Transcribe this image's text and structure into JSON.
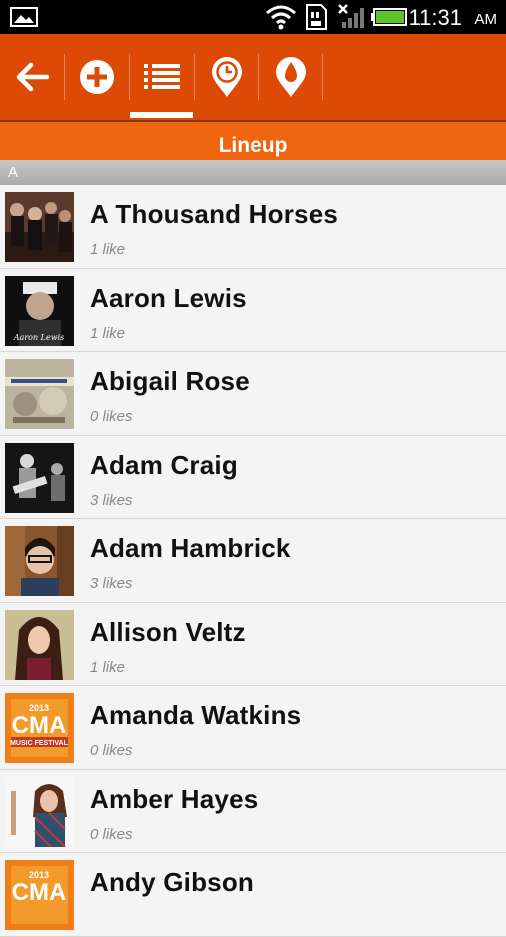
{
  "status_bar": {
    "time": "11:31",
    "ampm": "AM",
    "icons": [
      "photo-icon",
      "wifi-icon",
      "sd-card-icon",
      "no-signal-icon",
      "battery-icon"
    ]
  },
  "toolbar": {
    "buttons": [
      {
        "name": "back",
        "icon": "arrow-left-icon"
      },
      {
        "name": "add",
        "icon": "plus-circle-icon"
      },
      {
        "name": "lineup",
        "icon": "list-icon",
        "selected": true
      },
      {
        "name": "schedule",
        "icon": "clock-pin-icon"
      },
      {
        "name": "water",
        "icon": "drop-pin-icon"
      }
    ],
    "color": "#dd4a06"
  },
  "title": "Lineup",
  "section_header": "A",
  "artists": [
    {
      "name": "A Thousand Horses",
      "likes": "1 like",
      "thumb": "band-photo"
    },
    {
      "name": "Aaron Lewis",
      "likes": "1 like",
      "thumb": "portrait-photo",
      "caption": "Aaron Lewis"
    },
    {
      "name": "Abigail Rose",
      "likes": "0 likes",
      "thumb": "collage-photo"
    },
    {
      "name": "Adam Craig",
      "likes": "3 likes",
      "thumb": "concert-photo"
    },
    {
      "name": "Adam Hambrick",
      "likes": "3 likes",
      "thumb": "portrait-photo"
    },
    {
      "name": "Allison Veltz",
      "likes": "1 like",
      "thumb": "portrait-photo"
    },
    {
      "name": "Amanda Watkins",
      "likes": "0 likes",
      "thumb": "cma-logo"
    },
    {
      "name": "Amber Hayes",
      "likes": "0 likes",
      "thumb": "portrait-photo"
    },
    {
      "name": "Andy Gibson",
      "likes": "",
      "thumb": "cma-logo"
    }
  ],
  "cma_logo": {
    "year": "2013",
    "line1": "CMA",
    "line2": "MUSIC FESTIVAL"
  }
}
